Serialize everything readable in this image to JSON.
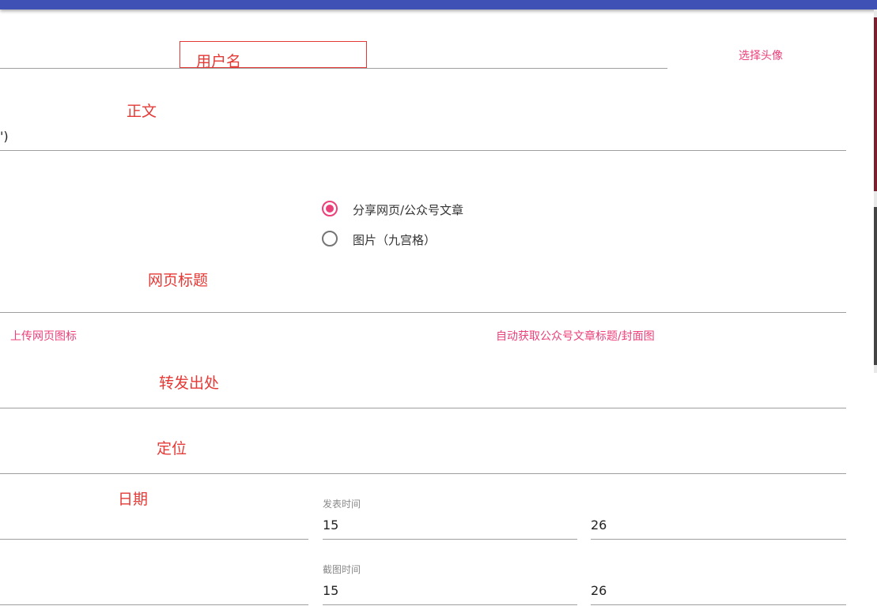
{
  "header": {
    "color": "#3f51b5"
  },
  "colors": {
    "accent": "#ec407a",
    "annotation": "#e53935",
    "underline": "#9e9e9e"
  },
  "username": {
    "annotation": "用户名"
  },
  "avatar": {
    "link": "选择头像"
  },
  "body_text": {
    "annotation": "正文",
    "value_fragment": "')"
  },
  "content_type": {
    "options": [
      {
        "label": "分享网页/公众号文章",
        "checked": true
      },
      {
        "label": "图片（九宫格）",
        "checked": false
      }
    ]
  },
  "web_title": {
    "annotation": "网页标题"
  },
  "links": {
    "upload_icon": "上传网页图标",
    "auto_fetch": "自动获取公众号文章标题/封面图"
  },
  "source": {
    "annotation": "转发出处"
  },
  "location": {
    "annotation": "定位"
  },
  "date": {
    "annotation": "日期"
  },
  "publish_time": {
    "label": "发表时间",
    "hour": "15",
    "minute": "26"
  },
  "screenshot_time": {
    "label": "截图时间",
    "hour": "15",
    "minute": "26"
  }
}
